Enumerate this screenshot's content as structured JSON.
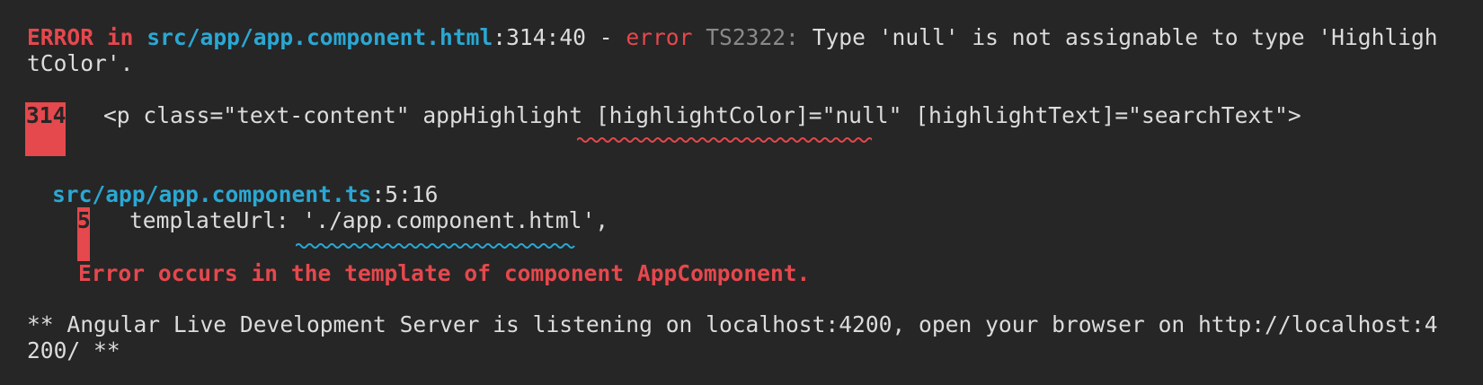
{
  "error_header": {
    "error_label": "ERROR",
    "in_label": "in",
    "file": "src/app/app.component.html",
    "location": ":314:40 - ",
    "error_word": "error",
    "code": "TS2322:",
    "message_part1": "Type 'null' is not assignable to type 'Highligh",
    "message_part2": "tColor'."
  },
  "template_snippet": {
    "line_number": "314",
    "code_before": "<p class=\"text-content\" appHighlight ",
    "code_highlight": "[highlightColor]=\"null\"",
    "code_after": " [highlightText]=\"searchText\">"
  },
  "component_ref": {
    "file": "src/app/app.component.ts",
    "location": ":5:16",
    "line_number": "5",
    "code_before": "templateUrl: ",
    "code_highlight": "'./app.component.html'",
    "code_after": ",",
    "note": "Error occurs in the template of component AppComponent."
  },
  "server_message": {
    "line1": "** Angular Live Development Server is listening on localhost:4200, open your browser on http://localhost:4",
    "line2": "200/ **"
  },
  "colors": {
    "background": "#262626",
    "error_red": "#e5484d",
    "path_cyan": "#2aa8d4",
    "text": "#dcdcdc",
    "muted": "#8a8a8a"
  }
}
